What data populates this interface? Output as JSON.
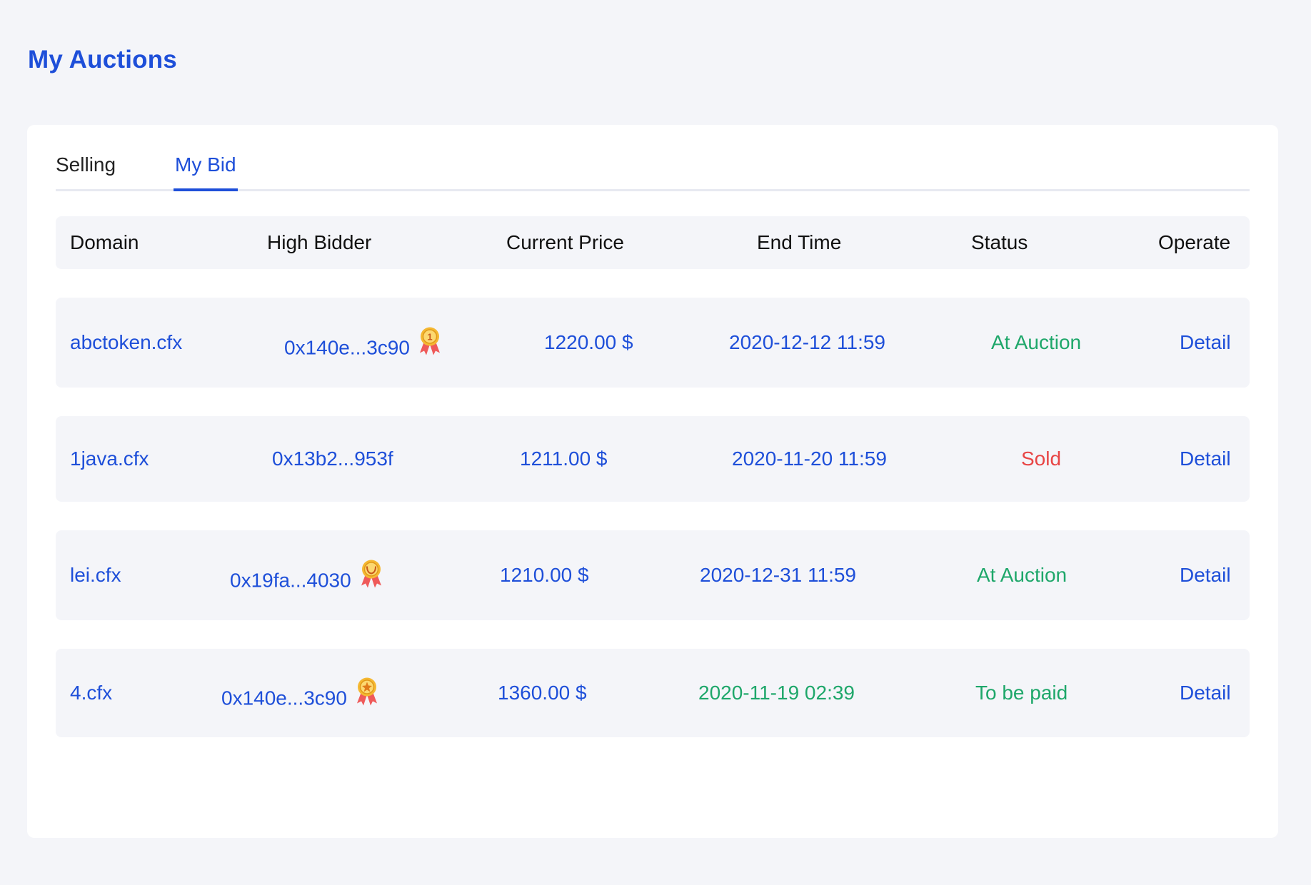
{
  "page": {
    "title": "My Auctions"
  },
  "tabs": [
    {
      "label": "Selling",
      "active": false
    },
    {
      "label": "My Bid",
      "active": true
    }
  ],
  "table": {
    "columns": [
      "Domain",
      "High Bidder",
      "Current Price",
      "End Time",
      "Status",
      "Operate"
    ],
    "rows": [
      {
        "domain": "abctoken.cfx",
        "bidder": "0x140e...3c90",
        "bidder_badge": "first-place-medal-icon",
        "price": "1220.00 $",
        "end_time": "2020-12-12 11:59",
        "end_time_color": "#1e4fd9",
        "status": "At Auction",
        "status_color": "#1ea76a",
        "operate": "Detail"
      },
      {
        "domain": "1java.cfx",
        "bidder": "0x13b2...953f",
        "bidder_badge": "",
        "price": "1211.00 $",
        "end_time": "2020-11-20 11:59",
        "end_time_color": "#1e4fd9",
        "status": "Sold",
        "status_color": "#e84545",
        "operate": "Detail"
      },
      {
        "domain": "lei.cfx",
        "bidder": "0x19fa...4030",
        "bidder_badge": "laurel-medal-icon",
        "price": "1210.00 $",
        "end_time": "2020-12-31 11:59",
        "end_time_color": "#1e4fd9",
        "status": "At Auction",
        "status_color": "#1ea76a",
        "operate": "Detail"
      },
      {
        "domain": "4.cfx",
        "bidder": "0x140e...3c90",
        "bidder_badge": "star-medal-icon",
        "price": "1360.00 $",
        "end_time": "2020-11-19 02:39",
        "end_time_color": "#1ea76a",
        "status": "To be paid",
        "status_color": "#1ea76a",
        "operate": "Detail"
      }
    ]
  },
  "colors": {
    "accent": "#1e4fd9",
    "success": "#1ea76a",
    "danger": "#e84545",
    "background": "#f4f5f9",
    "medal_gold": "#f5b832",
    "ribbon_red": "#ef5a5a"
  }
}
